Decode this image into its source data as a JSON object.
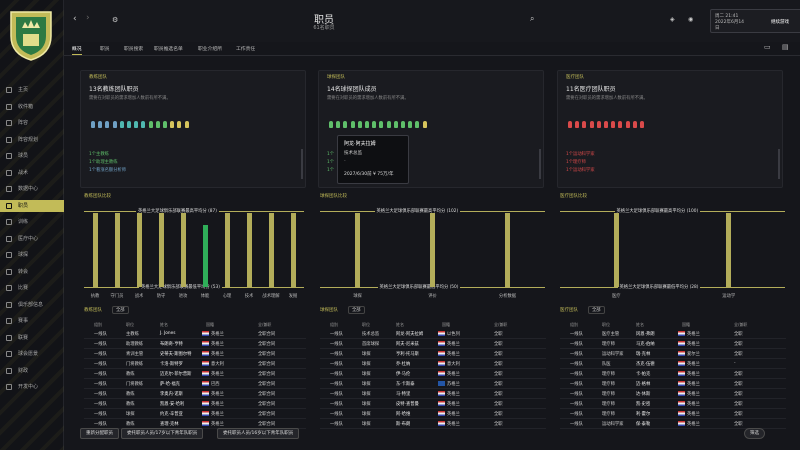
{
  "header": {
    "title": "职员",
    "subtitle": "61名职员"
  },
  "date": {
    "line1": "周二 21:41",
    "line2": "2022年6月14",
    "line3": "日",
    "continue": "继续游戏"
  },
  "sidebar": {
    "items": [
      "主页",
      "收件箱",
      "阵容",
      "阵容规划",
      "球员",
      "战术",
      "数据中心",
      "职员",
      "训练",
      "医疗中心",
      "球探",
      "转会",
      "比赛",
      "俱乐部信息",
      "赛事",
      "联赛",
      "球会愿景",
      "财政",
      "开发中心"
    ]
  },
  "tabs": [
    "概况",
    "职员",
    "职员搜索",
    "职员推选名单",
    "职业介绍所",
    "工作责任"
  ],
  "panels": [
    {
      "tag": "教练团队",
      "heading": "13名教练团队职员",
      "desc": "需要在对职员的需求增加人数前有所不满。",
      "reqs": [
        "1个主教练",
        "1个助理主教练",
        "1个看涨名额分析师"
      ]
    },
    {
      "tag": "球探团队",
      "heading": "14名球探团队成员",
      "desc": "需要在对职员的需求增加人数前有所不满。",
      "reqs": [
        "1个",
        "1个",
        "1个"
      ]
    },
    {
      "tag": "医疗团队",
      "heading": "11名医疗团队职员",
      "desc": "需要在对职员的需求增加人数前有所不满。",
      "reqs": [
        "1个运动科学家",
        "1个理疗师",
        "1个运动科学家"
      ]
    }
  ],
  "tooltip": {
    "name": "阿龙·阿夫拉姆",
    "role": "技术总监",
    "line": "-",
    "contract": "2027/6/30前 ¥ 75万/年"
  },
  "chart_data": [
    {
      "type": "bar",
      "title": "教练团队比较",
      "legend_top": "英格兰大足球俱乐部联赛最高平均分 (87)",
      "legend_bottom": "英格兰大足球俱乐部联赛最低平均分 (53)",
      "categories": [
        "执教",
        "守门员",
        "战术",
        "防守",
        "进攻",
        "体能",
        "心理",
        "技术",
        "战术理解",
        "发掘"
      ]
    },
    {
      "type": "bar",
      "title": "球探团队比较",
      "legend_top": "英格兰大足球俱乐部联赛最高平均分 (102)",
      "legend_bottom": "英格兰大足球俱乐部联赛最低平均分 (50)",
      "categories": [
        "球探",
        "评价",
        "分析数据"
      ]
    },
    {
      "type": "bar",
      "title": "医疗团队比较",
      "legend_top": "英格兰大足球俱乐部联赛最高平均分 (100)",
      "legend_bottom": "英格兰大足球俱乐部联赛最低平均分 (28)",
      "categories": [
        "医疗",
        "运动学"
      ]
    }
  ],
  "tables": [
    {
      "title": "教练团队",
      "filter": "全部",
      "cols": [
        "组别",
        "职位",
        "姓名",
        "国籍",
        "全/兼职"
      ],
      "rows": [
        [
          "一线队",
          "主教练",
          "J. Jones",
          "英格兰",
          "全职合同"
        ],
        [
          "一线队",
          "助理教练",
          "布朗奇·亨特",
          "英格兰",
          "全职合同"
        ],
        [
          "一线队",
          "青训主管",
          "史蒂夫·斯图尔特",
          "英格兰",
          "全职合同"
        ],
        [
          "一线队",
          "门将教练",
          "卡洛·斯特罗",
          "意大利",
          "全职合同"
        ],
        [
          "一线队",
          "教练",
          "迈克尔·菲尔普斯",
          "英格兰",
          "全职合同"
        ],
        [
          "一线队",
          "门将教练",
          "萨·哈·福克",
          "巴西",
          "全职合同"
        ],
        [
          "一线队",
          "教练",
          "李奥内·诺斯",
          "英格兰",
          "全职合同"
        ],
        [
          "一线队",
          "教练",
          "凯恩·安·哈利",
          "英格兰",
          "全职合同"
        ],
        [
          "一线队",
          "球探",
          "约克·辛普亚",
          "英格兰",
          "全职合同"
        ],
        [
          "一线队",
          "教练",
          "查理·克林",
          "英格兰",
          "全职合同"
        ]
      ]
    },
    {
      "title": "球探团队",
      "filter": "全部",
      "cols": [
        "组别",
        "职位",
        "姓名",
        "国籍",
        "全/兼职"
      ],
      "rows": [
        [
          "一线队",
          "技术总监",
          "阿龙·阿夫拉姆",
          "以色列",
          "全职"
        ],
        [
          "一线队",
          "首席球探",
          "阿夫·尼米兹",
          "英格兰",
          "全职"
        ],
        [
          "一线队",
          "球探",
          "亨利·托马斯",
          "英格兰",
          "全职"
        ],
        [
          "一线队",
          "球探",
          "乔·杜纳",
          "意大利",
          "全职"
        ],
        [
          "一线队",
          "球探",
          "伊·马伦",
          "英格兰",
          "全职"
        ],
        [
          "一线队",
          "球探",
          "东·卡斯泰",
          "苏格兰",
          "全职"
        ],
        [
          "一线队",
          "球探",
          "马·特里",
          "英格兰",
          "全职"
        ],
        [
          "一线队",
          "球探",
          "皮特·查普曼",
          "英格兰",
          "全职"
        ],
        [
          "一线队",
          "球探",
          "阿·哈维",
          "英格兰",
          "全职"
        ],
        [
          "一线队",
          "球探",
          "斯·布朗",
          "英格兰",
          "全职"
        ]
      ]
    },
    {
      "title": "医疗团队",
      "filter": "全部",
      "cols": [
        "组别",
        "职位",
        "姓名",
        "国籍",
        "全/兼职"
      ],
      "rows": [
        [
          "一线队",
          "医疗主管",
          "冈恩·弗朗",
          "英格兰",
          "全职"
        ],
        [
          "一线队",
          "理疗师",
          "马克·伯纳",
          "英格兰",
          "全职"
        ],
        [
          "一线队",
          "运动科学家",
          "瑞·克林",
          "爱尔兰",
          "全职"
        ],
        [
          "一线队",
          "队医",
          "杰克·伍德",
          "英格兰",
          "-"
        ],
        [
          "一线队",
          "理疗师",
          "卡·帕克",
          "英格兰",
          "全职"
        ],
        [
          "一线队",
          "理疗师",
          "迈·格林",
          "英格兰",
          "全职"
        ],
        [
          "一线队",
          "理疗师",
          "达·休斯",
          "英格兰",
          "全职"
        ],
        [
          "一线队",
          "理疗师",
          "凯·史密",
          "英格兰",
          "全职"
        ],
        [
          "一线队",
          "理疗师",
          "利·霍尔",
          "英格兰",
          "全职"
        ],
        [
          "一线队",
          "运动科学家",
          "保·泰勒",
          "英格兰",
          "全职"
        ]
      ]
    }
  ],
  "buttons": [
    "重新分配职员",
    "委托职员人员/17岁以下青年队职员",
    "委托职员人员/16岁以下青年队职员"
  ],
  "bottom_right": "筛选"
}
